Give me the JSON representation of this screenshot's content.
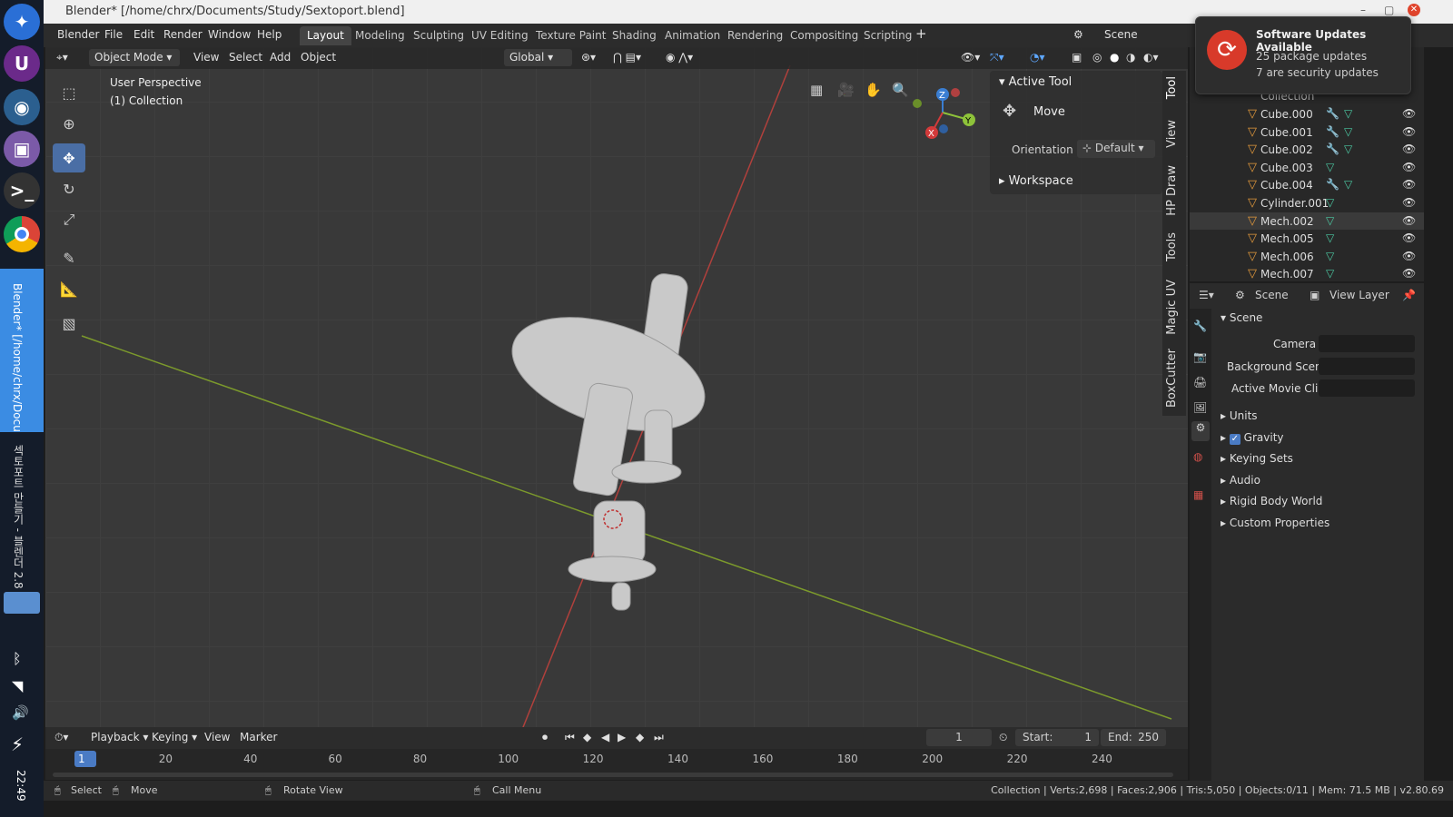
{
  "taskbar": {
    "clock": "22:49",
    "active_app_label": "Blender* [/home/chrx/Docu",
    "second_label": "섹토포트 만들기 - 블렌더 2.8"
  },
  "window": {
    "title": "Blender* [/home/chrx/Documents/Study/Sextoport.blend]"
  },
  "menu": {
    "items": [
      "Blender",
      "File",
      "Edit",
      "Render",
      "Window",
      "Help"
    ]
  },
  "workspaces": [
    "Layout",
    "Modeling",
    "Sculpting",
    "UV Editing",
    "Texture Paint",
    "Shading",
    "Animation",
    "Rendering",
    "Compositing",
    "Scripting"
  ],
  "scene_selector": "Scene",
  "viewport_header": {
    "mode": "Object Mode",
    "menus": [
      "View",
      "Select",
      "Add",
      "Object"
    ],
    "orientation": "Global"
  },
  "viewport_info": {
    "perspective": "User Perspective",
    "collection": "(1) Collection"
  },
  "gizmo": {
    "x": "X",
    "y": "Y",
    "z": "Z"
  },
  "npanel": {
    "active_tool_title": "Active Tool",
    "tool_name": "Move",
    "orientation_label": "Orientation",
    "orientation_value": "Default",
    "workspace_title": "Workspace",
    "tabs": [
      "Tool",
      "View",
      "HP Draw",
      "Tools",
      "Magic UV",
      "BoxCutter"
    ]
  },
  "notification": {
    "title": "Software Updates Available",
    "line1": "25 package updates",
    "line2": "7 are security updates"
  },
  "outliner": {
    "collection_label": "Collection",
    "items": [
      {
        "name": "Cube.000",
        "modifier": true
      },
      {
        "name": "Cube.001",
        "modifier": true
      },
      {
        "name": "Cube.002",
        "modifier": true
      },
      {
        "name": "Cube.003",
        "modifier": false
      },
      {
        "name": "Cube.004",
        "modifier": true
      },
      {
        "name": "Cylinder.001",
        "modifier": false
      },
      {
        "name": "Mech.002",
        "modifier": false,
        "selected": true
      },
      {
        "name": "Mech.005",
        "modifier": false
      },
      {
        "name": "Mech.006",
        "modifier": false
      },
      {
        "name": "Mech.007",
        "modifier": false
      }
    ]
  },
  "properties": {
    "scene_tab": "Scene",
    "view_layer_tab": "View Layer",
    "section_title": "Scene",
    "camera_label": "Camera",
    "background_scene_label": "Background Scene",
    "active_movie_clip_label": "Active Movie Clip",
    "sections": [
      "Units",
      "Gravity",
      "Keying Sets",
      "Audio",
      "Rigid Body World",
      "Custom Properties"
    ],
    "gravity_checked": true
  },
  "timeline": {
    "menus": [
      "Playback",
      "Keying",
      "View",
      "Marker"
    ],
    "current_frame": "1",
    "start_label": "Start:",
    "start_value": "1",
    "end_label": "End:",
    "end_value": "250",
    "ruler": [
      "1",
      "20",
      "40",
      "60",
      "80",
      "100",
      "120",
      "140",
      "160",
      "180",
      "200",
      "220",
      "240"
    ]
  },
  "statusbar": {
    "select": "Select",
    "move": "Move",
    "rotate_view": "Rotate View",
    "call_menu": "Call Menu",
    "stats": "Collection | Verts:2,698 | Faces:2,906 | Tris:5,050 | Objects:0/11 | Mem: 71.5 MB | v2.80.69"
  },
  "colors": {
    "accent_blue": "#4a6ea5",
    "x_axis": "#d23a3a",
    "y_axis": "#8ec33a",
    "z_axis": "#3a7ed2",
    "object_orange": "#e49a3c",
    "mesh_green": "#4cc9a3"
  }
}
